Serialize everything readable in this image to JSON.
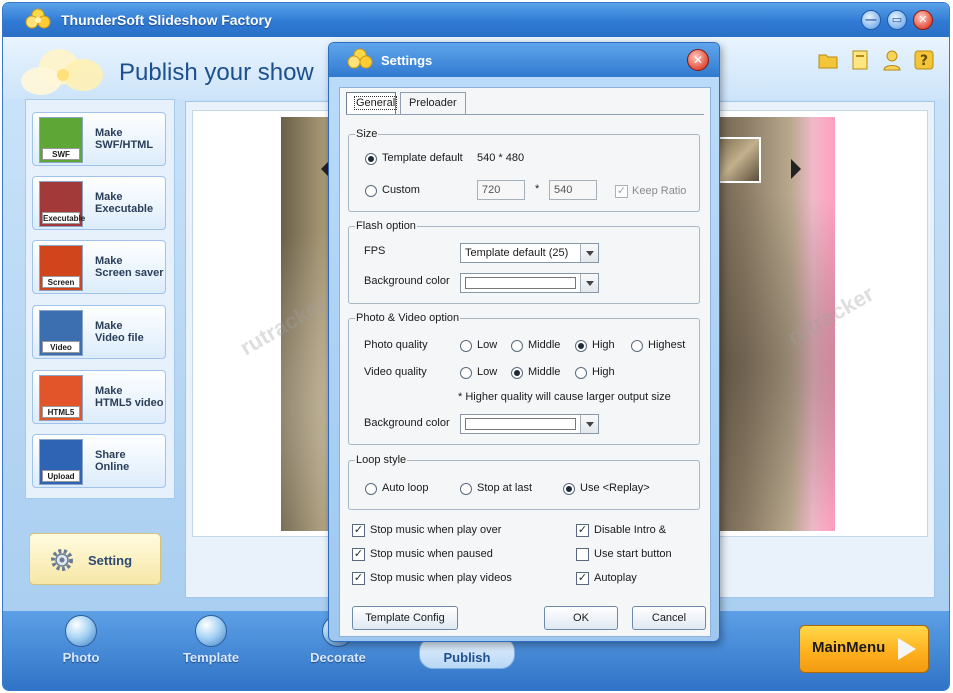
{
  "app": {
    "title": "ThunderSoft Slideshow Factory",
    "banner_title": "Publish your show"
  },
  "make_items": [
    {
      "label": "Make\nSWF/HTML",
      "thumb_tag": "SWF",
      "color": "#5ea636"
    },
    {
      "label": "Make\nExecutable",
      "thumb_tag": "Executable",
      "color": "#a23a3a"
    },
    {
      "label": "Make\nScreen saver",
      "thumb_tag": "Screen",
      "color": "#d0451c"
    },
    {
      "label": "Make\nVideo file",
      "thumb_tag": "Video",
      "color": "#3c6fb0"
    },
    {
      "label": "Make\nHTML5 video",
      "thumb_tag": "HTML5",
      "color": "#e2552a"
    },
    {
      "label": "Share\nOnline",
      "thumb_tag": "Upload",
      "color": "#2f64b5"
    }
  ],
  "setting_button": "Setting",
  "bottom_tabs": [
    {
      "label": "Photo"
    },
    {
      "label": "Template"
    },
    {
      "label": "Decorate"
    },
    {
      "label": "Publish"
    }
  ],
  "main_menu": "MainMenu",
  "dialog": {
    "title": "Settings",
    "tabs": [
      "General",
      "Preloader"
    ],
    "size": {
      "legend": "Size",
      "template_default_label": "Template default",
      "template_default_value": "540 * 480",
      "custom_label": "Custom",
      "width": "720",
      "times": "*",
      "height": "540",
      "keep_ratio": "Keep Ratio"
    },
    "flash": {
      "legend": "Flash option",
      "fps_label": "FPS",
      "fps_value": "Template default (25)",
      "bg_label": "Background color"
    },
    "photo_video": {
      "legend": "Photo & Video option",
      "photo_quality_label": "Photo quality",
      "video_quality_label": "Video quality",
      "opt_low": "Low",
      "opt_middle": "Middle",
      "opt_high": "High",
      "opt_highest": "Highest",
      "note": "* Higher quality will cause larger output size",
      "bg_label": "Background color"
    },
    "loop": {
      "legend": "Loop style",
      "auto": "Auto loop",
      "stop": "Stop at last",
      "replay": "Use <Replay>"
    },
    "checks": {
      "stop_play_over": "Stop music when play over",
      "stop_paused": "Stop music when paused",
      "stop_videos": "Stop music when play videos",
      "disable_intro": "Disable Intro &",
      "use_start": "Use start button",
      "autoplay": "Autoplay"
    },
    "buttons": {
      "template_config": "Template Config",
      "ok": "OK",
      "cancel": "Cancel"
    }
  }
}
